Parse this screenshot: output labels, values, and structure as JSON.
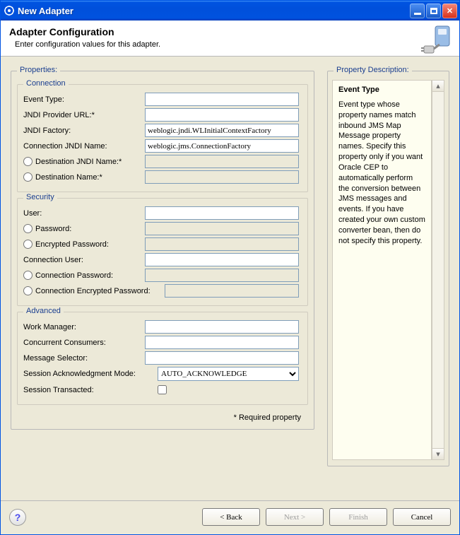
{
  "window": {
    "title": "New Adapter"
  },
  "header": {
    "title": "Adapter Configuration",
    "subtext": "Enter configuration values for this adapter."
  },
  "properties_label": "Properties:",
  "connection": {
    "legend": "Connection",
    "event_type_label": "Event Type:",
    "event_type_value": "",
    "jndi_provider_label": "JNDI Provider URL:*",
    "jndi_provider_value": "",
    "jndi_factory_label": "JNDI Factory:",
    "jndi_factory_value": "weblogic.jndi.WLInitialContextFactory",
    "conn_jndi_label": "Connection JNDI Name:",
    "conn_jndi_value": "weblogic.jms.ConnectionFactory",
    "dest_jndi_label": "Destination JNDI Name:*",
    "dest_jndi_value": "",
    "dest_name_label": "Destination Name:*",
    "dest_name_value": ""
  },
  "security": {
    "legend": "Security",
    "user_label": "User:",
    "user_value": "",
    "password_label": "Password:",
    "password_value": "",
    "enc_password_label": "Encrypted Password:",
    "enc_password_value": "",
    "conn_user_label": "Connection User:",
    "conn_user_value": "",
    "conn_password_label": "Connection Password:",
    "conn_password_value": "",
    "conn_enc_password_label": "Connection Encrypted Password:",
    "conn_enc_password_value": ""
  },
  "advanced": {
    "legend": "Advanced",
    "work_manager_label": "Work Manager:",
    "work_manager_value": "",
    "concurrent_label": "Concurrent Consumers:",
    "concurrent_value": "",
    "selector_label": "Message Selector:",
    "selector_value": "",
    "ack_label": "Session Acknowledgment Mode:",
    "ack_value": "AUTO_ACKNOWLEDGE",
    "transacted_label": "Session Transacted:"
  },
  "required_note": "* Required property",
  "description": {
    "legend": "Property Description:",
    "title": "Event Type",
    "body": "Event type whose property names match inbound JMS Map Message property names. Specify this property only if you want Oracle CEP to automatically perform the conversion between JMS messages and events. If you have created your own custom converter bean, then do not specify this property."
  },
  "footer": {
    "back": "< Back",
    "next": "Next >",
    "finish": "Finish",
    "cancel": "Cancel"
  }
}
